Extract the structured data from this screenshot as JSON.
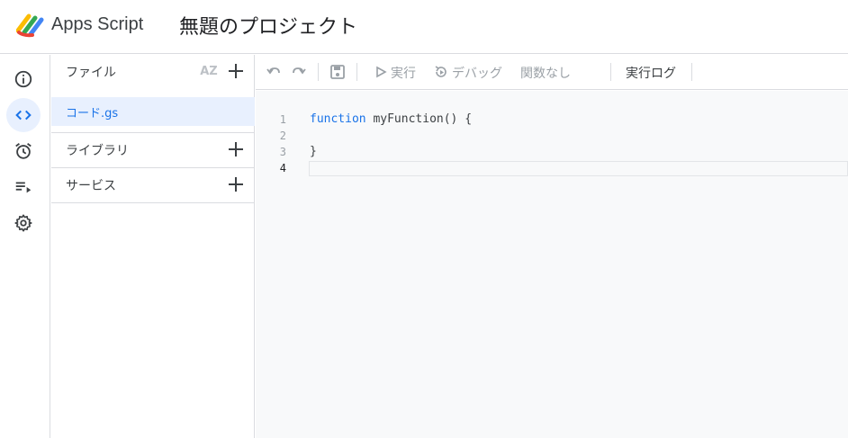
{
  "header": {
    "app_name": "Apps Script",
    "project_title": "無題のプロジェクト",
    "logo_icon": "apps-script-logo"
  },
  "rail": {
    "items": [
      {
        "icon": "info-icon",
        "active": false
      },
      {
        "icon": "code-icon",
        "active": true
      },
      {
        "icon": "alarm-clock-icon",
        "active": false
      },
      {
        "icon": "executions-icon",
        "active": false
      },
      {
        "icon": "gear-icon",
        "active": false
      }
    ]
  },
  "files_panel": {
    "files_label": "ファイル",
    "sort_icon_label": "AZ",
    "files": [
      {
        "name": "コード.gs",
        "selected": true
      }
    ],
    "libraries_label": "ライブラリ",
    "services_label": "サービス"
  },
  "toolbar": {
    "undo_icon": "undo-icon",
    "redo_icon": "redo-icon",
    "save_icon": "save-icon",
    "run_label": "実行",
    "debug_label": "デバッグ",
    "function_select": "関数なし",
    "execution_log_label": "実行ログ"
  },
  "editor": {
    "lines": [
      {
        "num": "1",
        "keyword": "function",
        "rest": " myFunction() {"
      },
      {
        "num": "2",
        "keyword": "",
        "rest": ""
      },
      {
        "num": "3",
        "keyword": "",
        "rest": "}"
      },
      {
        "num": "4",
        "keyword": "",
        "rest": ""
      }
    ],
    "current_line": "4"
  },
  "colors": {
    "accent": "#1a73e8",
    "active_bg": "#e8f0fe",
    "border": "#dadce0",
    "editor_bg": "#f8f9fa"
  }
}
